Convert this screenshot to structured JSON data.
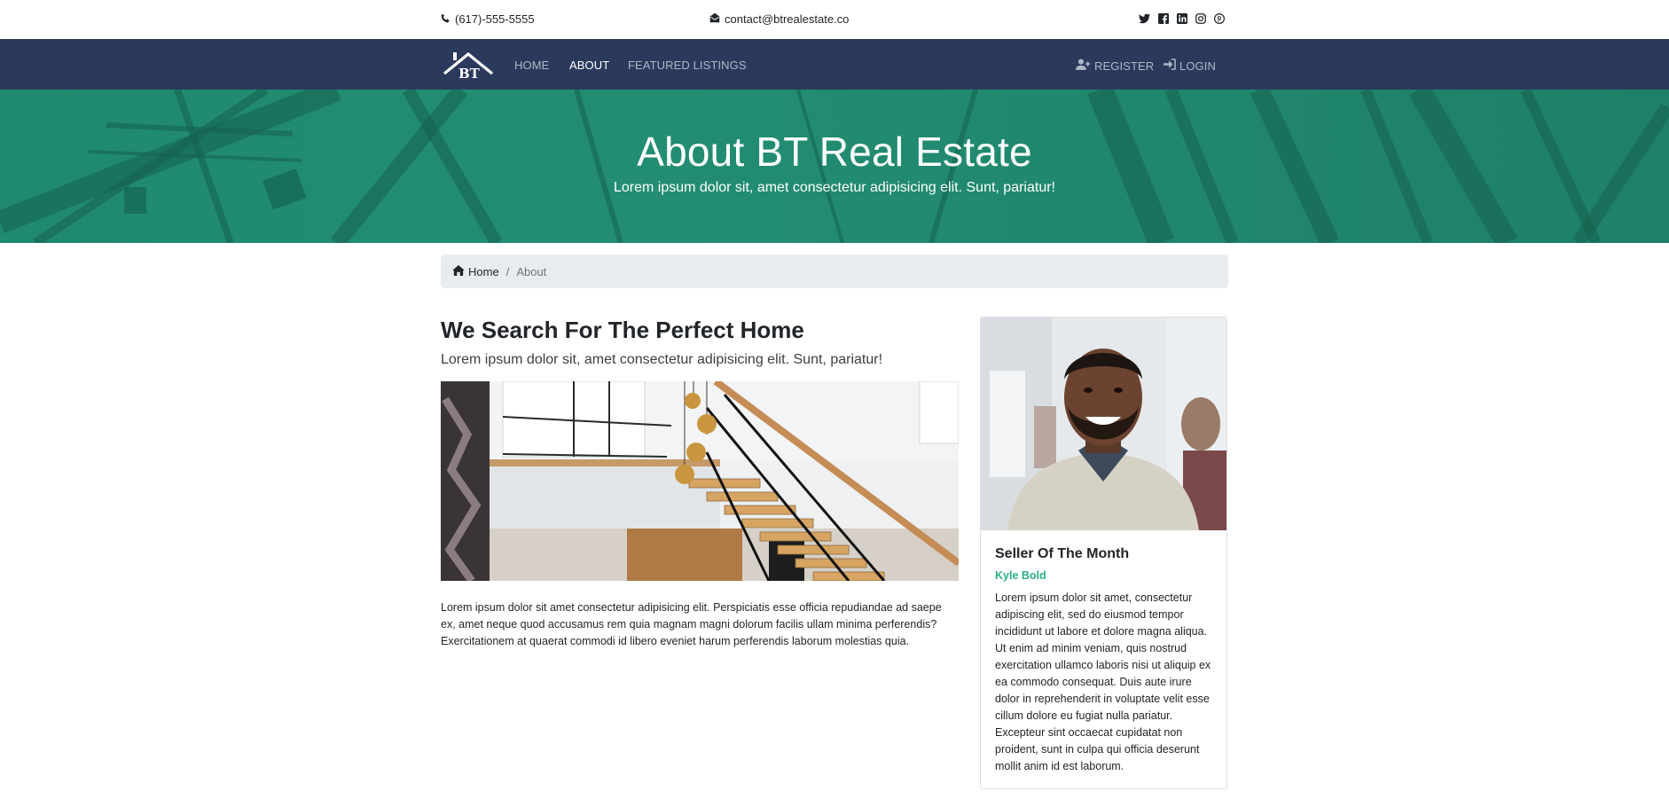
{
  "topbar": {
    "phone": "(617)-555-5555",
    "email": "contact@btrealestate.co",
    "social_icons": [
      "twitter-icon",
      "facebook-icon",
      "linkedin-icon",
      "instagram-icon",
      "pinterest-icon"
    ]
  },
  "navbar": {
    "logo_text": "BT",
    "links": [
      {
        "label": "HOME",
        "active": false
      },
      {
        "label": "ABOUT",
        "active": true
      },
      {
        "label": "FEATURED LISTINGS",
        "active": false
      }
    ],
    "register_label": "REGISTER",
    "login_label": "LOGIN"
  },
  "hero": {
    "title": "About BT Real Estate",
    "subtitle": "Lorem ipsum dolor sit, amet consectetur adipisicing elit. Sunt, pariatur!"
  },
  "breadcrumb": {
    "home": "Home",
    "current": "About"
  },
  "main": {
    "title": "We Search For The Perfect Home",
    "lead": "Lorem ipsum dolor sit, amet consectetur adipisicing elit. Sunt, pariatur!",
    "paragraph": "Lorem ipsum dolor sit amet consectetur adipisicing elit. Perspiciatis esse officia repudiandae ad saepe ex, amet neque quod accusamus rem quia magnam magni dolorum facilis ullam minima perferendis? Exercitationem at quaerat commodi id libero eveniet harum perferendis laborum molestias quia."
  },
  "seller": {
    "title": "Seller Of The Month",
    "name": "Kyle Bold",
    "bio": "Lorem ipsum dolor sit amet, consectetur adipiscing elit, sed do eiusmod tempor incididunt ut labore et dolore magna aliqua. Ut enim ad minim veniam, quis nostrud exercitation ullamco laboris nisi ut aliquip ex ea commodo consequat. Duis aute irure dolor in reprehenderit in voluptate velit esse cillum dolore eu fugiat nulla pariatur. Excepteur sint occaecat cupidatat non proident, sunt in culpa qui officia deserunt mollit anim id est laborum."
  },
  "colors": {
    "navbar_bg": "#2b3a5c",
    "hero_bg": "#218a70",
    "accent_green": "#28b088",
    "breadcrumb_bg": "#e9ecef"
  }
}
